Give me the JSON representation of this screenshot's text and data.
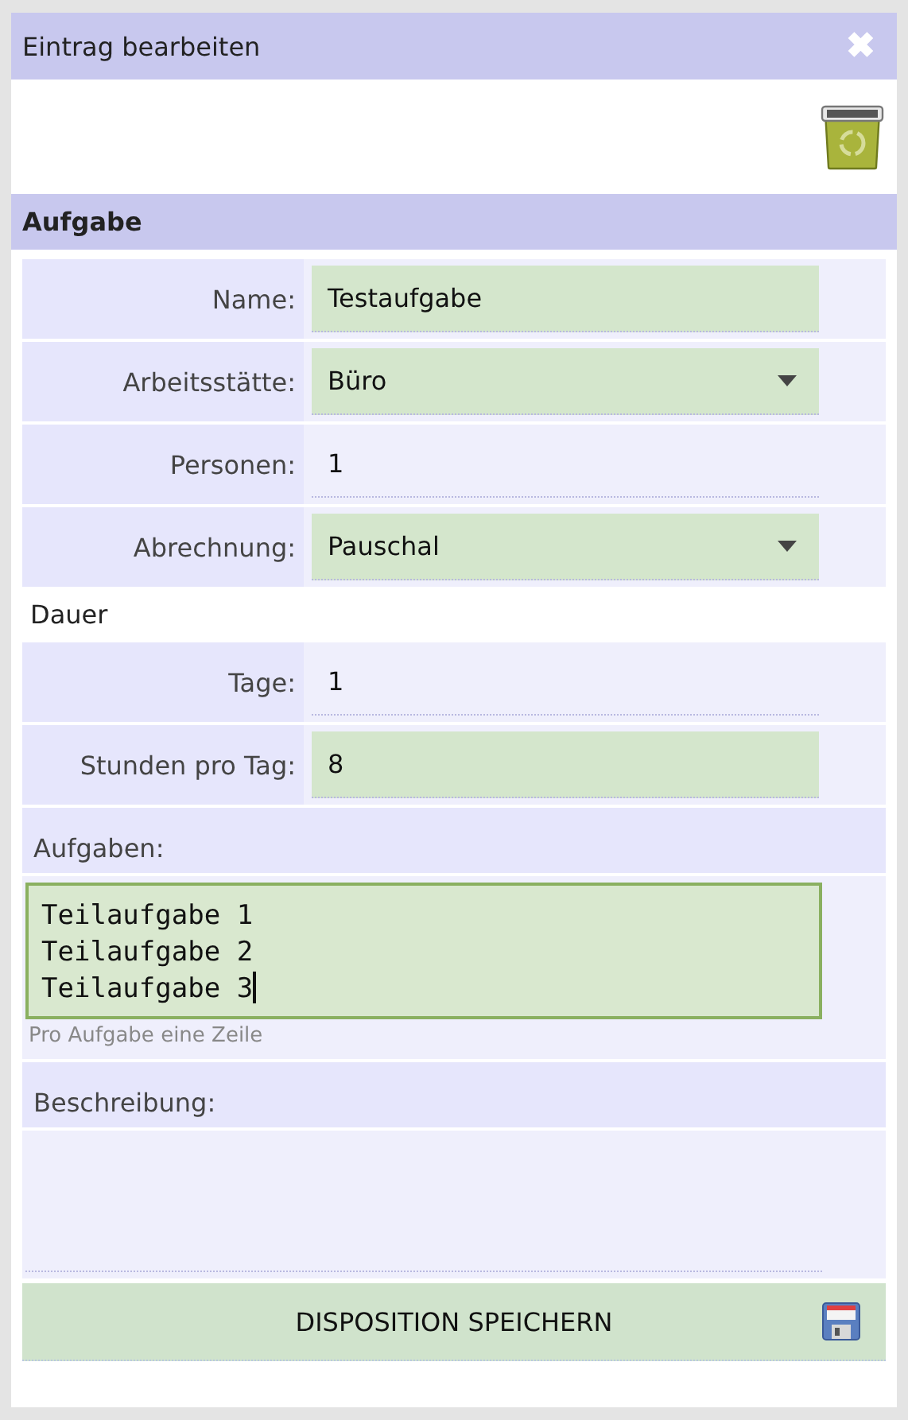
{
  "dialog": {
    "title": "Eintrag bearbeiten",
    "close": "✖"
  },
  "section": {
    "title": "Aufgabe"
  },
  "fields": [
    {
      "label": "Name:",
      "kind": "input",
      "value": "Testaufgabe",
      "highlighted": true
    },
    {
      "label": "Arbeitsstätte:",
      "kind": "select",
      "value": "Büro",
      "highlighted": true
    },
    {
      "label": "Personen:",
      "kind": "input",
      "value": "1",
      "highlighted": false
    },
    {
      "label": "Abrechnung:",
      "kind": "select",
      "value": "Pauschal",
      "highlighted": true
    }
  ],
  "duration": {
    "title": "Dauer",
    "fields": [
      {
        "label": "Tage:",
        "value": "1",
        "highlighted": false
      },
      {
        "label": "Stunden pro Tag:",
        "value": "8",
        "highlighted": true
      }
    ]
  },
  "tasks": {
    "label": "Aufgaben:",
    "lines": [
      "Teilaufgabe 1",
      "Teilaufgabe 2",
      "Teilaufgabe 3"
    ],
    "focused": true,
    "hint": "Pro Aufgabe eine Zeile"
  },
  "description": {
    "label": "Beschreibung:"
  },
  "save_button": {
    "label": "DISPOSITION SPEICHERN"
  }
}
